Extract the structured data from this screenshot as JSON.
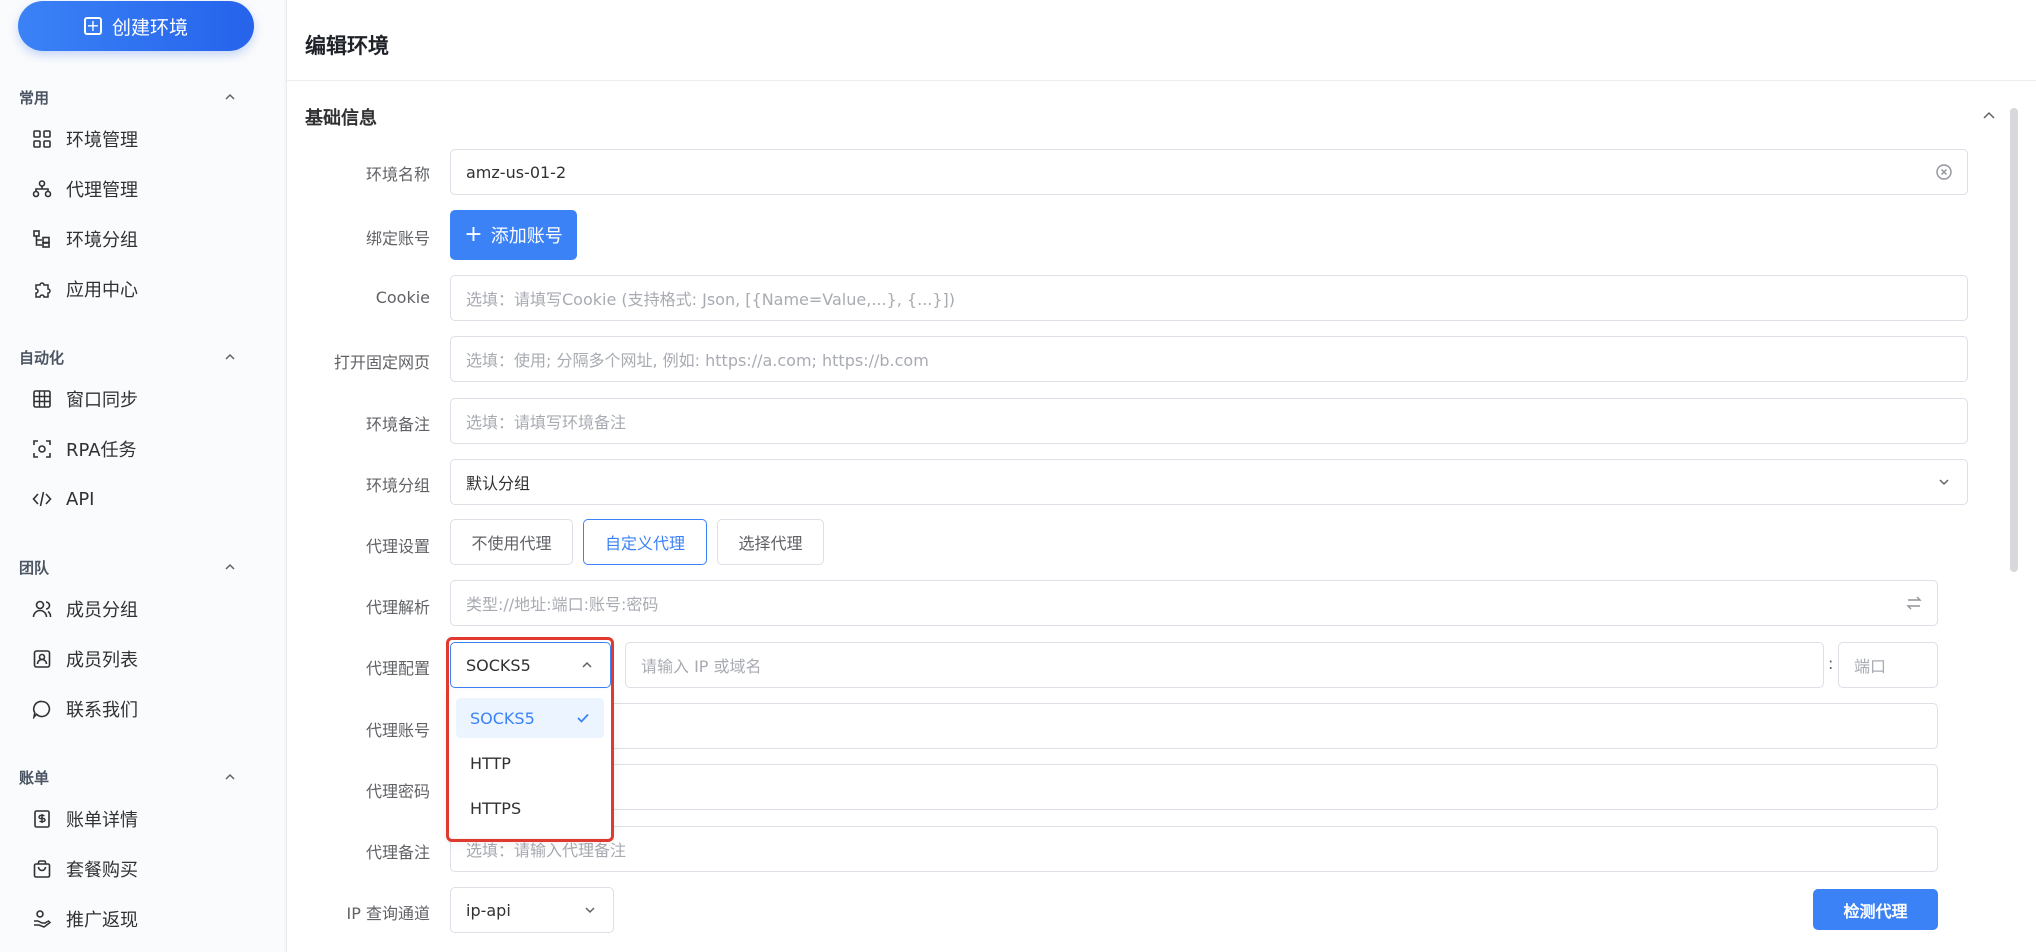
{
  "sidebar": {
    "create_button": "创建环境",
    "sections": [
      {
        "title": "常用",
        "items": [
          "环境管理",
          "代理管理",
          "环境分组",
          "应用中心"
        ]
      },
      {
        "title": "自动化",
        "items": [
          "窗口同步",
          "RPA任务",
          "API"
        ]
      },
      {
        "title": "团队",
        "items": [
          "成员分组",
          "成员列表",
          "联系我们"
        ]
      },
      {
        "title": "账单",
        "items": [
          "账单详情",
          "套餐购买",
          "推广返现"
        ]
      }
    ]
  },
  "header": {
    "title": "编辑环境"
  },
  "card": {
    "title": "基础信息"
  },
  "form": {
    "env_name": {
      "label": "环境名称",
      "value": "amz-us-01-2"
    },
    "bind_account": {
      "label": "绑定账号",
      "button": "添加账号"
    },
    "cookie": {
      "label": "Cookie",
      "placeholder": "选填：请填写Cookie (支持格式: Json, [{Name=Value,...}, {...}])"
    },
    "open_pages": {
      "label": "打开固定网页",
      "placeholder": "选填：使用; 分隔多个网址, 例如: https://a.com; https://b.com"
    },
    "env_note": {
      "label": "环境备注",
      "placeholder": "选填：请填写环境备注"
    },
    "env_group": {
      "label": "环境分组",
      "value": "默认分组"
    },
    "proxy_setting": {
      "label": "代理设置",
      "options": [
        "不使用代理",
        "自定义代理",
        "选择代理"
      ],
      "active": "自定义代理"
    },
    "proxy_parse": {
      "label": "代理解析",
      "placeholder": "类型://地址:端口:账号:密码"
    },
    "proxy_config": {
      "label": "代理配置",
      "type_value": "SOCKS5",
      "host_placeholder": "请输入 IP 或域名",
      "colon": ":",
      "port_placeholder": "端口"
    },
    "proxy_account": {
      "label": "代理账号"
    },
    "proxy_password": {
      "label": "代理密码"
    },
    "proxy_note": {
      "label": "代理备注",
      "placeholder": "选填：请输入代理备注"
    },
    "ip_channel": {
      "label": "IP 查询通道",
      "value": "ip-api"
    },
    "check_button": "检测代理"
  },
  "dropdown": {
    "options": [
      "SOCKS5",
      "HTTP",
      "HTTPS"
    ],
    "selected": "SOCKS5"
  },
  "colors": {
    "primary": "#3b82f6",
    "highlight": "#e0392f"
  }
}
